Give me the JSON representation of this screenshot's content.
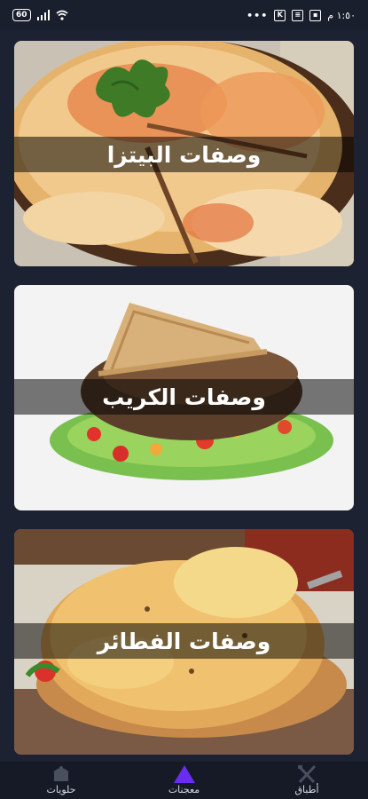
{
  "status_bar": {
    "battery": "60",
    "time": "١:٥٠ م"
  },
  "cards": [
    {
      "title": "وصفات البيتزا",
      "image": "pizza"
    },
    {
      "title": "وصفات الكريب",
      "image": "crepe"
    },
    {
      "title": "وصفات الفطائر",
      "image": "pie"
    }
  ],
  "nav": {
    "left": {
      "label": "حلويات",
      "icon": "cake-icon"
    },
    "center": {
      "label": "معجنات",
      "icon": "triangle-icon",
      "color": "#6a2cf0"
    },
    "right": {
      "label": "أطباق",
      "icon": "utensils-icon"
    }
  },
  "colors": {
    "background": "#1d2233",
    "band": "rgba(0,0,0,0.52)",
    "accent": "#6a2cf0"
  }
}
